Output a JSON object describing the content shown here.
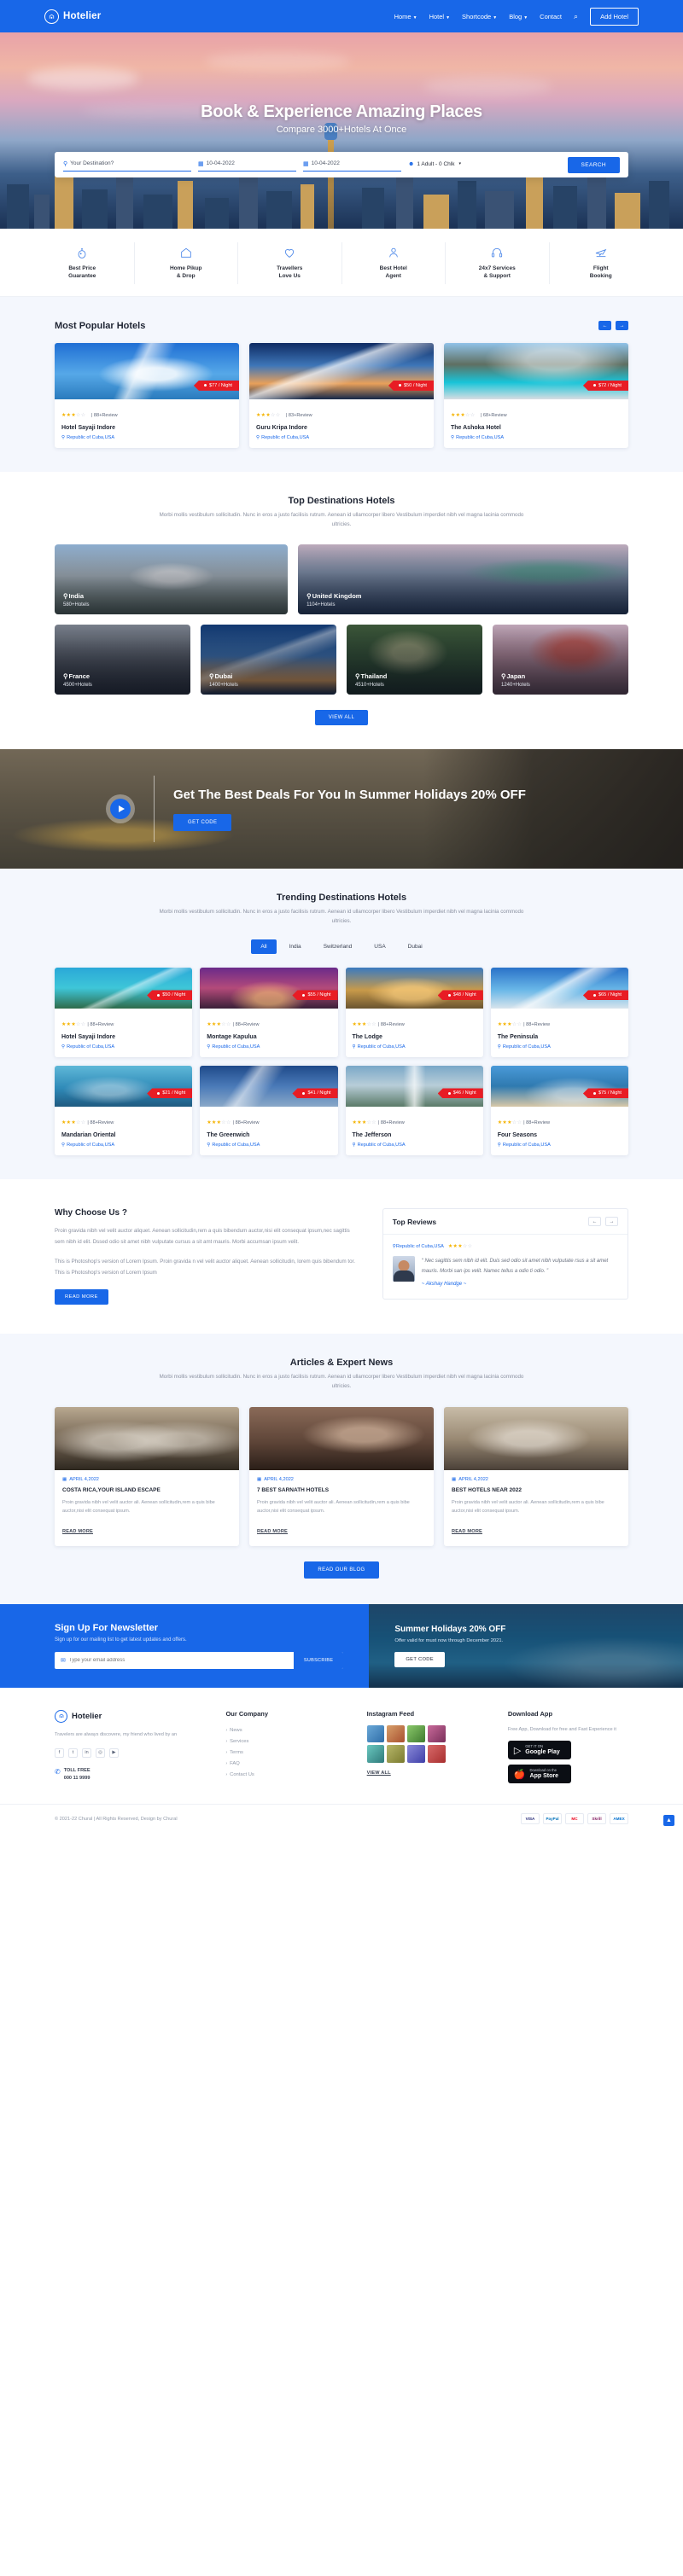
{
  "brand": {
    "name": "Hotelier",
    "logo_icon": "hotel-logo-icon"
  },
  "nav": {
    "items": [
      {
        "label": "Home",
        "has_dropdown": true
      },
      {
        "label": "Hotel",
        "has_dropdown": true
      },
      {
        "label": "Shortcode",
        "has_dropdown": true
      },
      {
        "label": "Blog",
        "has_dropdown": true
      },
      {
        "label": "Contact",
        "has_dropdown": false
      }
    ],
    "search_icon": "search-icon",
    "add_hotel_label": "Add Hotel"
  },
  "hero": {
    "title": "Book & Experience Amazing Places",
    "subtitle": "Compare 3000+Hotels At Once",
    "search": {
      "destination_placeholder": "Your Destination?",
      "checkin": "10-04-2022",
      "checkout": "10-04-2022",
      "guests": "1 Adult - 0 Chlk",
      "button_label": "SEARCH"
    }
  },
  "features": [
    {
      "icon": "piggy-bank-icon",
      "label": "Best Price\nGuarantee"
    },
    {
      "icon": "home-icon",
      "label": "Home Pikup\n& Drop"
    },
    {
      "icon": "heart-icon",
      "label": "Travellers\nLove Us"
    },
    {
      "icon": "agent-icon",
      "label": "Best Hotel\nAgent"
    },
    {
      "icon": "headset-icon",
      "label": "24x7 Services\n& Support"
    },
    {
      "icon": "plane-icon",
      "label": "Flight\nBooking"
    }
  ],
  "popular": {
    "title": "Most Popular Hotels",
    "hotels": [
      {
        "name": "Hotel Sayaji Indore",
        "price": "$77 / Night",
        "stars": 3,
        "reviews": "88+Review",
        "location": "Republic of Cuba,USA"
      },
      {
        "name": "Guru Kripa Indore",
        "price": "$50 / Night",
        "stars": 3,
        "reviews": "83+Review",
        "location": "Republic of Cuba,USA"
      },
      {
        "name": "The Ashoka Hotel",
        "price": "$72 / Night",
        "stars": 3,
        "reviews": "68+Review",
        "location": "Republic of Cuba,USA"
      }
    ]
  },
  "destinations": {
    "title": "Top Destinations Hotels",
    "description": "Morbi mollis vestibulum sollicitudin. Nunc in eros a justo facilisis rutrum. Aenean id ullamcorper libero Vestibulum imperdiet nibh vel magna lacinia commodo ultricies.",
    "row1": [
      {
        "name": "India",
        "count": "580+Hotels"
      },
      {
        "name": "United Kingdom",
        "count": "1104+Hotels"
      }
    ],
    "row2": [
      {
        "name": "France",
        "count": "4500+Hotels"
      },
      {
        "name": "Dubai",
        "count": "1400+Hotels"
      },
      {
        "name": "Thailand",
        "count": "4510+Hotels"
      },
      {
        "name": "Japan",
        "count": "1240+Hotels"
      }
    ],
    "view_all_label": "VIEW ALL"
  },
  "banner": {
    "title": "Get The Best Deals For You In Summer Holidays 20% OFF",
    "button_label": "GET CODE",
    "play_icon": "play-icon"
  },
  "trending": {
    "title": "Trending Destinations Hotels",
    "description": "Morbi mollis vestibulum sollicitudin. Nunc in eros a justo facilisis rutrum. Aenean id ullamcorper libero Vestibulum imperdiet nibh vel magna lacinia commodo ultricies.",
    "tabs": [
      "All",
      "India",
      "Switzerland",
      "USA",
      "Dubai"
    ],
    "active_tab": "All",
    "hotels": [
      {
        "name": "Hotel Sayaji Indore",
        "price": "$50 / Night",
        "stars": 3,
        "reviews": "88+Review",
        "location": "Republic of Cuba,USA"
      },
      {
        "name": "Montage Kapulua",
        "price": "$55 / Night",
        "stars": 3,
        "reviews": "88+Review",
        "location": "Republic of Cuba,USA"
      },
      {
        "name": "The Lodge",
        "price": "$48 / Night",
        "stars": 3,
        "reviews": "88+Review",
        "location": "Republic of Cuba,USA"
      },
      {
        "name": "The Peninsula",
        "price": "$65 / Night",
        "stars": 3,
        "reviews": "88+Review",
        "location": "Republic of Cuba,USA"
      },
      {
        "name": "Mandarian Oriental",
        "price": "$21 / Night",
        "stars": 3,
        "reviews": "88+Review",
        "location": "Republic of Cuba,USA"
      },
      {
        "name": "The Greenwich",
        "price": "$41 / Night",
        "stars": 3,
        "reviews": "88+Review",
        "location": "Republic of Cuba,USA"
      },
      {
        "name": "The Jefferson",
        "price": "$46 / Night",
        "stars": 3,
        "reviews": "88+Review",
        "location": "Republic of Cuba,USA"
      },
      {
        "name": "Four Seasons",
        "price": "$75 / Night",
        "stars": 3,
        "reviews": "88+Review",
        "location": "Republic of Cuba,USA"
      }
    ]
  },
  "why": {
    "title": "Why Choose Us ?",
    "para1": "Proin gravida nibh vel velit auctor aliquet. Aenean sollicitudin,rem a quis bibendum auctor,nisi elit consequat ipsum,nec sagittis sem nibh id elit. Dssed odio sit amet nibh vulputate cursus a sit amt mauris. Morbi accumsan ipsum velit.",
    "para2": "This is Photoshop's version of Lorem Ipsum. Proin gravida n vel velit auctor aliquet. Aenean sollicitudin, lorem quis bibendum tor. This is Photoshop's version of Lorem Ipsum",
    "read_more_label": "READ MORE"
  },
  "reviews": {
    "title": "Top Reviews",
    "prev_icon": "arrow-left-icon",
    "next_icon": "arrow-right-icon",
    "item": {
      "location": "Republic of Cuba,USA",
      "stars": 3,
      "quote": "“ Nec sagittis sem nibh id elit. Duis sed odio sit amet nibh vulputate rsus a sit amet mauris. Morbi san ips velit. Namec tellus a odio ti odio. ”",
      "author": "~ Akshay Handge ~"
    }
  },
  "articles": {
    "title": "Articles & Expert News",
    "description": "Morbi mollis vestibulum sollicitudin. Nunc in eros a justo facilisis rutrum. Aenean id ullamcorper libero Vestibulum imperdiet nibh vel magna lacinia commodo ultricies.",
    "items": [
      {
        "date": "APRIL 4,2022",
        "title": "COSTA RICA,YOUR ISLAND ESCAPE",
        "text": "Proin gravida nibh vel velit auctor ali. Aenean sollicitudin,rem a quis bibe auctor,nisi elit consequat ipsum.",
        "link": "READ MORE"
      },
      {
        "date": "APRIL 4,2022",
        "title": "7 BEST SARNATH HOTELS",
        "text": "Proin gravida nibh vel velit auctor ali. Aenean sollicitudin,rem a quis bibe auctor,nisi elit consequat ipsum.",
        "link": "READ MORE"
      },
      {
        "date": "APRIL 4,2022",
        "title": "BEST HOTELS NEAR 2022",
        "text": "Proin gravida nibh vel velit auctor ali. Aenean sollicitudin,rem a quis bibe auctor,nisi elit consequat ipsum.",
        "link": "READ MORE"
      }
    ],
    "read_blog_label": "READ OUR BLOG"
  },
  "newsletter": {
    "title": "Sign Up For Newsletter",
    "subtitle": "Sign up for our mailing list to get latest updates and offers.",
    "email_placeholder": "Type your email address",
    "submit_label": "SUBSCRIBE",
    "mail_icon": "mail-icon"
  },
  "offer": {
    "title": "Summer Holidays 20% OFF",
    "subtitle": "Offer valid for must now through December 2021.",
    "button_label": "GET CODE"
  },
  "footer": {
    "about": {
      "brand": "Hotelier",
      "text": "Travelers are always discovere, my friend who lived by an"
    },
    "social": [
      {
        "icon": "facebook-icon",
        "glyph": "f"
      },
      {
        "icon": "twitter-icon",
        "glyph": "t"
      },
      {
        "icon": "linkedin-icon",
        "glyph": "in"
      },
      {
        "icon": "instagram-icon",
        "glyph": "◎"
      },
      {
        "icon": "youtube-icon",
        "glyph": "▶"
      }
    ],
    "phone": {
      "icon": "phone-icon",
      "line1": "TOLL FREE",
      "line2": "000 11 9999"
    },
    "company": {
      "heading": "Our Company",
      "links": [
        "News",
        "Services",
        "Terms",
        "FAQ",
        "Contact Us"
      ]
    },
    "instagram": {
      "heading": "Instagram Feed",
      "view_all": "VIEW ALL"
    },
    "download": {
      "heading": "Download App",
      "note": "Free App, Download for free and Fast Experience it",
      "google": {
        "small": "GET IT ON",
        "big": "Google Play",
        "icon": "google-play-icon"
      },
      "apple": {
        "small": "Download on the",
        "big": "App Store",
        "icon": "apple-icon"
      }
    },
    "copyright": "© 2021-22 Chural | All Rights Reserved, Design by Chural",
    "payments": [
      "VISA",
      "PayPal",
      "MC",
      "Skrill",
      "AMEX"
    ],
    "to_top_icon": "arrow-up-icon"
  },
  "colors": {
    "accent": "#1867e8",
    "price": "#e81c24",
    "star": "#f5b301",
    "section_bg": "#f4f7fd"
  }
}
